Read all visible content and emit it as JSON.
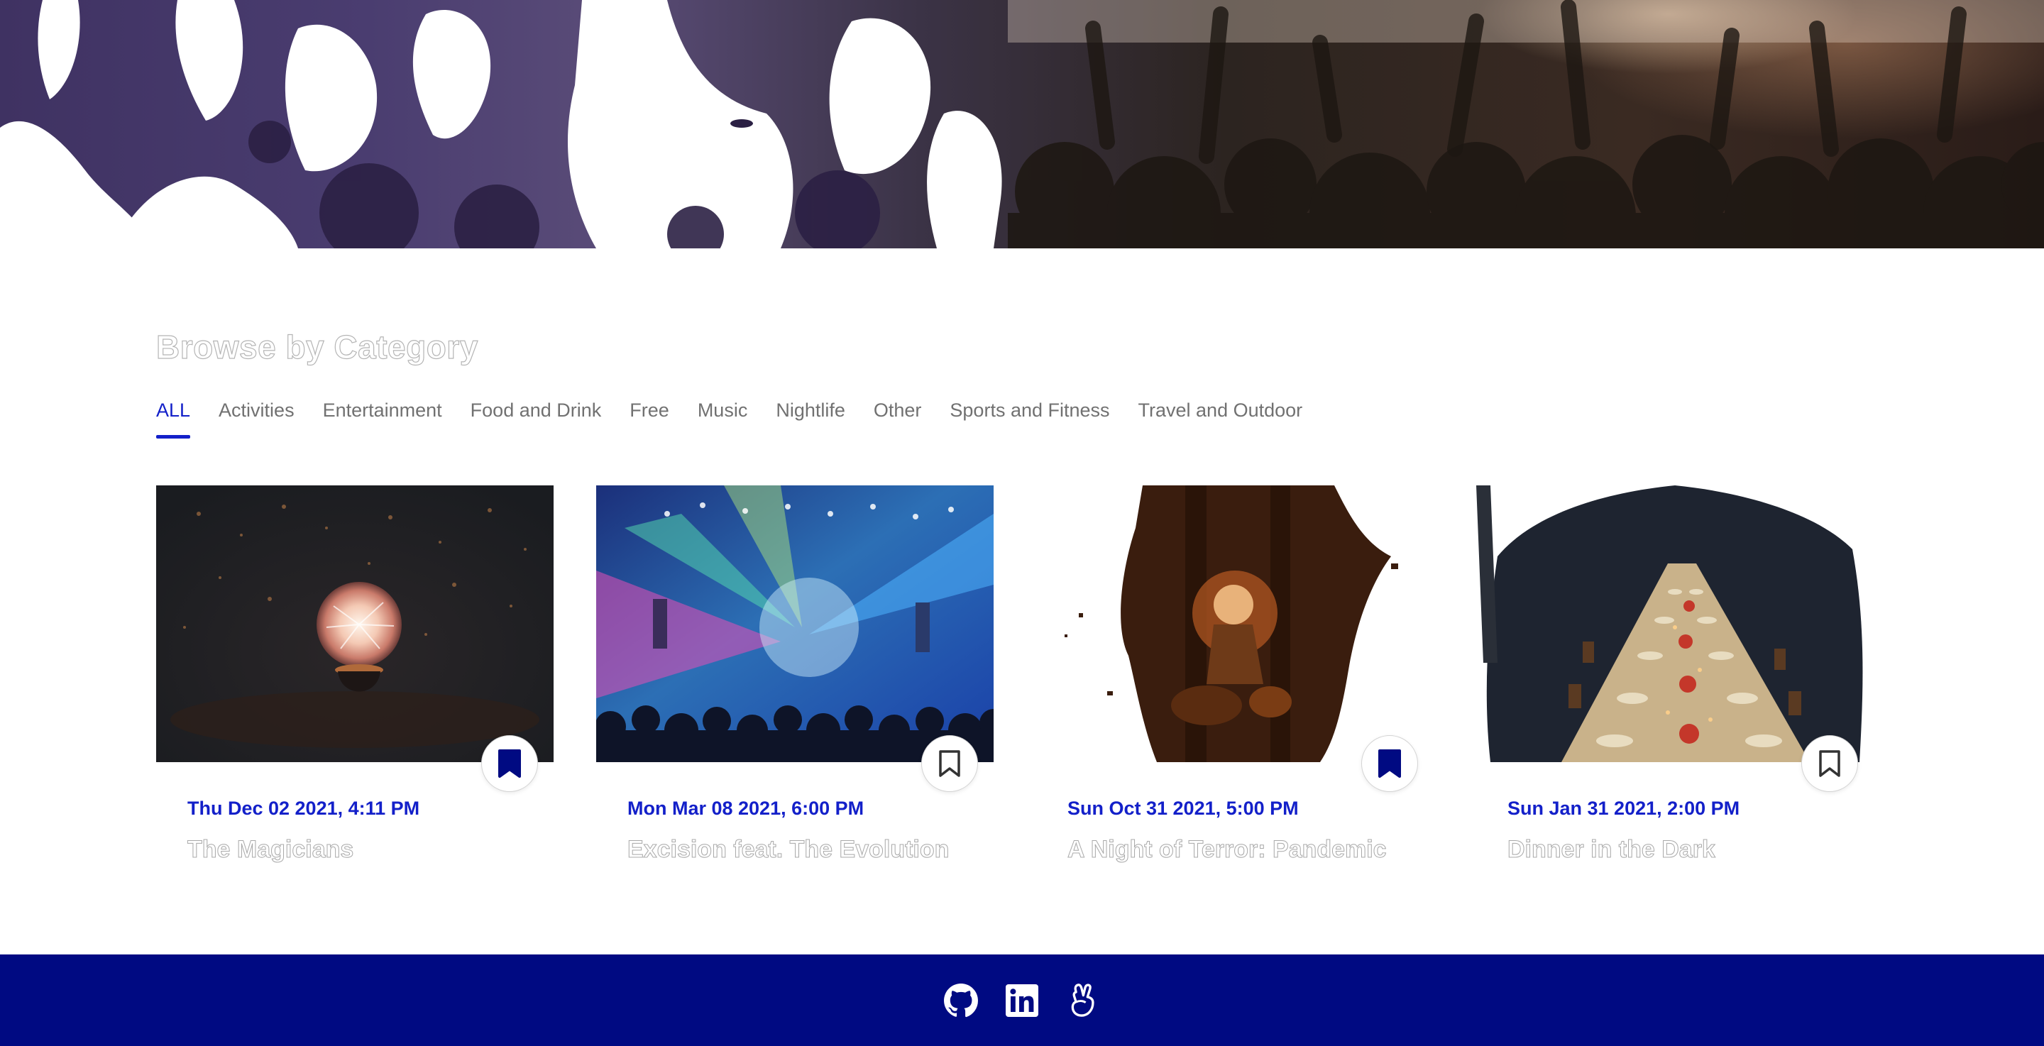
{
  "hero": {
    "image": "concert-crowd-banner"
  },
  "section": {
    "title": "Browse by Category"
  },
  "tabs": [
    {
      "label": "ALL",
      "active": true
    },
    {
      "label": "Activities",
      "active": false
    },
    {
      "label": "Entertainment",
      "active": false
    },
    {
      "label": "Food and Drink",
      "active": false
    },
    {
      "label": "Free",
      "active": false
    },
    {
      "label": "Music",
      "active": false
    },
    {
      "label": "Nightlife",
      "active": false
    },
    {
      "label": "Other",
      "active": false
    },
    {
      "label": "Sports and Fitness",
      "active": false
    },
    {
      "label": "Travel and Outdoor",
      "active": false
    }
  ],
  "events": [
    {
      "date": "Thu Dec 02 2021, 4:11 PM",
      "title": "The Magicians",
      "bookmarked": true,
      "image": "plasma-ball-on-dark-stage"
    },
    {
      "date": "Mon Mar 08 2021, 6:00 PM",
      "title": "Excision feat. The Evolution",
      "bookmarked": false,
      "image": "edm-concert-lights"
    },
    {
      "date": "Sun Oct 31 2021, 5:00 PM",
      "title": "A Night of Terror: Pandemic",
      "bookmarked": true,
      "image": "halloween-scarecrow-barn"
    },
    {
      "date": "Sun Jan 31 2021, 2:00 PM",
      "title": "Dinner in the Dark",
      "bookmarked": false,
      "image": "candlelit-banquet-table"
    }
  ],
  "footer": {
    "links": [
      {
        "icon": "github-icon"
      },
      {
        "icon": "linkedin-icon"
      },
      {
        "icon": "angellist-icon"
      }
    ]
  },
  "colors": {
    "accent": "#1320c9",
    "footer_bg": "#000a82",
    "bookmark_fill": "#000a82",
    "muted_text": "#717171"
  }
}
